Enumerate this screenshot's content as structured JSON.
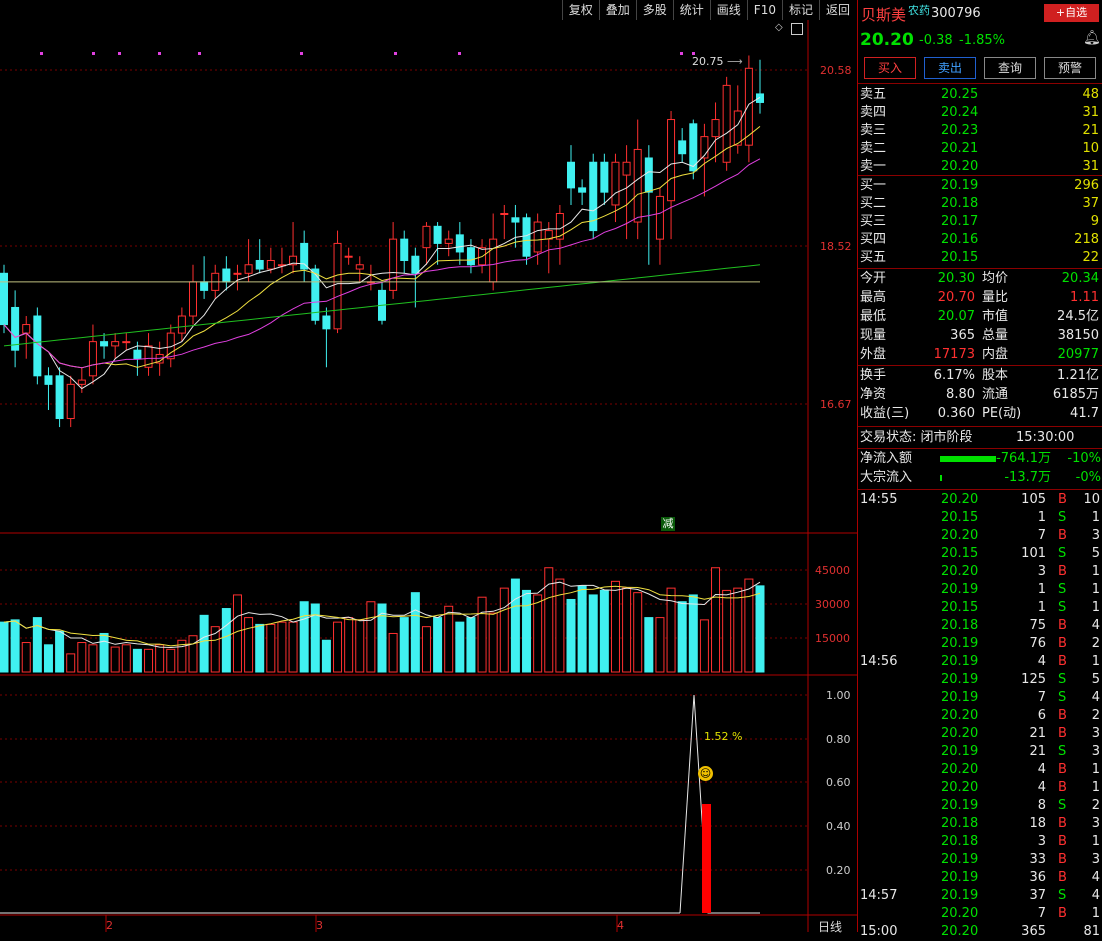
{
  "toolbar": {
    "items": [
      "复权",
      "叠加",
      "多股",
      "统计",
      "画线",
      "F10",
      "标记",
      "返回"
    ]
  },
  "price_axis": [
    "20.58",
    "18.52",
    "16.67"
  ],
  "volume_axis": [
    "45000",
    "30000",
    "15000"
  ],
  "indicator_axis": [
    "1.00",
    "0.80",
    "0.60",
    "0.40",
    "0.20"
  ],
  "date_axis": [
    "2",
    "3",
    "4"
  ],
  "bottom_label": "日线",
  "chart_labels": {
    "high_note": "20.75",
    "reduce_badge": "减",
    "indicator_value": "1.52",
    "indicator_unit": "%"
  },
  "stock": {
    "name": "贝斯美",
    "tag": "农药",
    "code": "300796",
    "add_fav": "+自选",
    "price": "20.20",
    "change": "-0.38",
    "change_pct": "-1.85%"
  },
  "actions": [
    "买入",
    "卖出",
    "查询",
    "预警"
  ],
  "asks": [
    {
      "label": "卖五",
      "price": "20.25",
      "vol": "48"
    },
    {
      "label": "卖四",
      "price": "20.24",
      "vol": "31"
    },
    {
      "label": "卖三",
      "price": "20.23",
      "vol": "21"
    },
    {
      "label": "卖二",
      "price": "20.21",
      "vol": "10"
    },
    {
      "label": "卖一",
      "price": "20.20",
      "vol": "31"
    }
  ],
  "bids": [
    {
      "label": "买一",
      "price": "20.19",
      "vol": "296"
    },
    {
      "label": "买二",
      "price": "20.18",
      "vol": "37"
    },
    {
      "label": "买三",
      "price": "20.17",
      "vol": "9"
    },
    {
      "label": "买四",
      "price": "20.16",
      "vol": "218"
    },
    {
      "label": "买五",
      "price": "20.15",
      "vol": "22"
    }
  ],
  "stats1": [
    {
      "l1": "今开",
      "v1": "20.30",
      "l2": "均价",
      "v2": "20.34"
    },
    {
      "l1": "最高",
      "v1": "20.70",
      "l2": "量比",
      "v2": "1.11"
    },
    {
      "l1": "最低",
      "v1": "20.07",
      "l2": "市值",
      "v2": "24.5亿"
    },
    {
      "l1": "现量",
      "v1": "365",
      "l2": "总量",
      "v2": "38150"
    },
    {
      "l1": "外盘",
      "v1": "17173",
      "l2": "内盘",
      "v2": "20977"
    }
  ],
  "stats2": [
    {
      "l1": "换手",
      "v1": "6.17%",
      "l2": "股本",
      "v2": "1.21亿"
    },
    {
      "l1": "净资",
      "v1": "8.80",
      "l2": "流通",
      "v2": "6185万"
    },
    {
      "l1": "收益(三)",
      "v1": "0.360",
      "l2": "PE(动)",
      "v2": "41.7"
    }
  ],
  "trade_status": {
    "label": "交易状态: 闭市阶段",
    "time": "15:30:00"
  },
  "flows": [
    {
      "label": "净流入额",
      "value": "-764.1万",
      "pct": "-10%"
    },
    {
      "label": "大宗流入",
      "value": "-13.7万",
      "pct": "-0%"
    }
  ],
  "ticks": [
    {
      "time": "14:55",
      "price": "20.20",
      "vol": "105",
      "side": "B",
      "n": "10"
    },
    {
      "time": "",
      "price": "20.15",
      "vol": "1",
      "side": "S",
      "n": "1"
    },
    {
      "time": "",
      "price": "20.20",
      "vol": "7",
      "side": "B",
      "n": "3"
    },
    {
      "time": "",
      "price": "20.15",
      "vol": "101",
      "side": "S",
      "n": "5"
    },
    {
      "time": "",
      "price": "20.20",
      "vol": "3",
      "side": "B",
      "n": "1"
    },
    {
      "time": "",
      "price": "20.19",
      "vol": "1",
      "side": "S",
      "n": "1"
    },
    {
      "time": "",
      "price": "20.15",
      "vol": "1",
      "side": "S",
      "n": "1"
    },
    {
      "time": "",
      "price": "20.18",
      "vol": "75",
      "side": "B",
      "n": "4"
    },
    {
      "time": "",
      "price": "20.19",
      "vol": "76",
      "side": "B",
      "n": "2"
    },
    {
      "time": "14:56",
      "price": "20.19",
      "vol": "4",
      "side": "B",
      "n": "1"
    },
    {
      "time": "",
      "price": "20.19",
      "vol": "125",
      "side": "S",
      "n": "5"
    },
    {
      "time": "",
      "price": "20.19",
      "vol": "7",
      "side": "S",
      "n": "4"
    },
    {
      "time": "",
      "price": "20.20",
      "vol": "6",
      "side": "B",
      "n": "2"
    },
    {
      "time": "",
      "price": "20.20",
      "vol": "21",
      "side": "B",
      "n": "3"
    },
    {
      "time": "",
      "price": "20.19",
      "vol": "21",
      "side": "S",
      "n": "3"
    },
    {
      "time": "",
      "price": "20.20",
      "vol": "4",
      "side": "B",
      "n": "1"
    },
    {
      "time": "",
      "price": "20.20",
      "vol": "4",
      "side": "B",
      "n": "1"
    },
    {
      "time": "",
      "price": "20.19",
      "vol": "8",
      "side": "S",
      "n": "2"
    },
    {
      "time": "",
      "price": "20.18",
      "vol": "18",
      "side": "B",
      "n": "3"
    },
    {
      "time": "",
      "price": "20.18",
      "vol": "3",
      "side": "B",
      "n": "1"
    },
    {
      "time": "",
      "price": "20.19",
      "vol": "33",
      "side": "B",
      "n": "3"
    },
    {
      "time": "",
      "price": "20.19",
      "vol": "36",
      "side": "B",
      "n": "4"
    },
    {
      "time": "14:57",
      "price": "20.19",
      "vol": "37",
      "side": "S",
      "n": "4"
    },
    {
      "time": "",
      "price": "20.20",
      "vol": "7",
      "side": "B",
      "n": "1"
    },
    {
      "time": "15:00",
      "price": "20.20",
      "vol": "365",
      "side": "",
      "n": "81"
    }
  ],
  "candles": [
    {
      "o": 18.2,
      "c": 17.6,
      "h": 18.3,
      "l": 17.5
    },
    {
      "o": 17.8,
      "c": 17.3,
      "h": 18.0,
      "l": 17.1
    },
    {
      "o": 17.5,
      "c": 17.6,
      "h": 17.7,
      "l": 17.2
    },
    {
      "o": 17.7,
      "c": 17.0,
      "h": 17.8,
      "l": 16.9
    },
    {
      "o": 17.0,
      "c": 16.9,
      "h": 17.1,
      "l": 16.6
    },
    {
      "o": 17.0,
      "c": 16.5,
      "h": 17.1,
      "l": 16.4
    },
    {
      "o": 16.5,
      "c": 16.9,
      "h": 17.0,
      "l": 16.4
    },
    {
      "o": 16.9,
      "c": 16.95,
      "h": 17.1,
      "l": 16.8
    },
    {
      "o": 17.0,
      "c": 17.4,
      "h": 17.6,
      "l": 16.9
    },
    {
      "o": 17.4,
      "c": 17.35,
      "h": 17.5,
      "l": 17.2
    },
    {
      "o": 17.35,
      "c": 17.4,
      "h": 17.5,
      "l": 17.2
    },
    {
      "o": 17.4,
      "c": 17.4,
      "h": 17.5,
      "l": 17.3
    },
    {
      "o": 17.3,
      "c": 17.2,
      "h": 17.4,
      "l": 17.0
    },
    {
      "o": 17.1,
      "c": 17.35,
      "h": 17.5,
      "l": 17.0
    },
    {
      "o": 17.15,
      "c": 17.25,
      "h": 17.4,
      "l": 17.0
    },
    {
      "o": 17.2,
      "c": 17.5,
      "h": 17.6,
      "l": 17.1
    },
    {
      "o": 17.5,
      "c": 17.7,
      "h": 17.8,
      "l": 17.4
    },
    {
      "o": 17.7,
      "c": 18.1,
      "h": 18.3,
      "l": 17.6
    },
    {
      "o": 18.1,
      "c": 18.0,
      "h": 18.4,
      "l": 17.9
    },
    {
      "o": 18.0,
      "c": 18.2,
      "h": 18.3,
      "l": 17.9
    },
    {
      "o": 18.25,
      "c": 18.1,
      "h": 18.4,
      "l": 18.0
    },
    {
      "o": 18.2,
      "c": 18.2,
      "h": 18.3,
      "l": 18.0
    },
    {
      "o": 18.2,
      "c": 18.3,
      "h": 18.6,
      "l": 18.1
    },
    {
      "o": 18.35,
      "c": 18.25,
      "h": 18.6,
      "l": 18.2
    },
    {
      "o": 18.25,
      "c": 18.35,
      "h": 18.5,
      "l": 18.2
    },
    {
      "o": 18.3,
      "c": 18.3,
      "h": 18.5,
      "l": 18.2
    },
    {
      "o": 18.3,
      "c": 18.4,
      "h": 18.8,
      "l": 18.2
    },
    {
      "o": 18.55,
      "c": 18.25,
      "h": 18.7,
      "l": 18.1
    },
    {
      "o": 18.25,
      "c": 17.65,
      "h": 18.3,
      "l": 17.6
    },
    {
      "o": 17.7,
      "c": 17.55,
      "h": 17.8,
      "l": 17.1
    },
    {
      "o": 17.55,
      "c": 18.55,
      "h": 18.7,
      "l": 17.5
    },
    {
      "o": 18.4,
      "c": 18.4,
      "h": 18.5,
      "l": 18.3
    },
    {
      "o": 18.25,
      "c": 18.3,
      "h": 18.4,
      "l": 18.1
    },
    {
      "o": 18.1,
      "c": 18.1,
      "h": 18.3,
      "l": 18.0
    },
    {
      "o": 18.0,
      "c": 17.65,
      "h": 18.1,
      "l": 17.6
    },
    {
      "o": 18.0,
      "c": 18.6,
      "h": 18.8,
      "l": 17.9
    },
    {
      "o": 18.6,
      "c": 18.35,
      "h": 18.7,
      "l": 18.2
    },
    {
      "o": 18.4,
      "c": 18.2,
      "h": 18.5,
      "l": 17.8
    },
    {
      "o": 18.5,
      "c": 18.75,
      "h": 18.8,
      "l": 18.3
    },
    {
      "o": 18.75,
      "c": 18.55,
      "h": 18.8,
      "l": 18.3
    },
    {
      "o": 18.55,
      "c": 18.6,
      "h": 18.7,
      "l": 18.4
    },
    {
      "o": 18.65,
      "c": 18.45,
      "h": 18.8,
      "l": 18.3
    },
    {
      "o": 18.5,
      "c": 18.3,
      "h": 18.6,
      "l": 18.2
    },
    {
      "o": 18.3,
      "c": 18.5,
      "h": 18.6,
      "l": 18.2
    },
    {
      "o": 18.1,
      "c": 18.6,
      "h": 18.9,
      "l": 18.0
    },
    {
      "o": 18.9,
      "c": 18.9,
      "h": 19.0,
      "l": 18.6
    },
    {
      "o": 18.85,
      "c": 18.8,
      "h": 19.0,
      "l": 18.5
    },
    {
      "o": 18.85,
      "c": 18.4,
      "h": 18.9,
      "l": 18.3
    },
    {
      "o": 18.45,
      "c": 18.8,
      "h": 18.9,
      "l": 18.3
    },
    {
      "o": 18.6,
      "c": 18.7,
      "h": 18.8,
      "l": 18.2
    },
    {
      "o": 18.6,
      "c": 18.9,
      "h": 19.0,
      "l": 18.3
    },
    {
      "o": 19.5,
      "c": 19.2,
      "h": 19.7,
      "l": 19.0
    },
    {
      "o": 19.2,
      "c": 19.15,
      "h": 19.3,
      "l": 19.0
    },
    {
      "o": 19.5,
      "c": 18.7,
      "h": 19.6,
      "l": 18.6
    },
    {
      "o": 19.5,
      "c": 19.15,
      "h": 19.6,
      "l": 19.0
    },
    {
      "o": 19.0,
      "c": 19.5,
      "h": 19.6,
      "l": 18.8
    },
    {
      "o": 19.35,
      "c": 19.5,
      "h": 19.7,
      "l": 18.6
    },
    {
      "o": 18.8,
      "c": 19.65,
      "h": 20.0,
      "l": 18.6
    },
    {
      "o": 19.55,
      "c": 19.15,
      "h": 19.7,
      "l": 18.3
    },
    {
      "o": 18.6,
      "c": 19.1,
      "h": 19.2,
      "l": 18.3
    },
    {
      "o": 19.05,
      "c": 20.0,
      "h": 20.1,
      "l": 18.6
    },
    {
      "o": 19.75,
      "c": 19.6,
      "h": 19.9,
      "l": 19.5
    },
    {
      "o": 19.95,
      "c": 19.4,
      "h": 20.0,
      "l": 19.3
    },
    {
      "o": 19.55,
      "c": 19.8,
      "h": 19.95,
      "l": 19.1
    },
    {
      "o": 19.8,
      "c": 20.0,
      "h": 20.2,
      "l": 19.5
    },
    {
      "o": 19.5,
      "c": 20.4,
      "h": 20.5,
      "l": 19.4
    },
    {
      "o": 19.7,
      "c": 20.1,
      "h": 20.4,
      "l": 19.6
    },
    {
      "o": 19.7,
      "c": 20.6,
      "h": 20.75,
      "l": 19.5
    },
    {
      "o": 20.3,
      "c": 20.2,
      "h": 20.7,
      "l": 20.07
    }
  ],
  "volumes": [
    22000,
    23000,
    13000,
    24000,
    12000,
    18000,
    8000,
    13000,
    12000,
    17000,
    11000,
    12000,
    10000,
    10000,
    12000,
    10000,
    14000,
    16000,
    25000,
    20000,
    28000,
    34000,
    24000,
    21000,
    21000,
    22000,
    22000,
    31000,
    30000,
    14000,
    22000,
    24000,
    23000,
    31000,
    30000,
    17000,
    24000,
    35000,
    20000,
    24000,
    29000,
    22000,
    24000,
    33000,
    26000,
    37000,
    41000,
    36000,
    34000,
    46000,
    41000,
    32000,
    38000,
    34000,
    36000,
    40000,
    37000,
    35000,
    24000,
    24000,
    37000,
    31000,
    34000,
    23000,
    46000,
    36000,
    37000,
    41000,
    38000
  ],
  "indicator": {
    "line": [
      0,
      0,
      0,
      1.0,
      0.5,
      0,
      0
    ],
    "bar": 0.5
  }
}
